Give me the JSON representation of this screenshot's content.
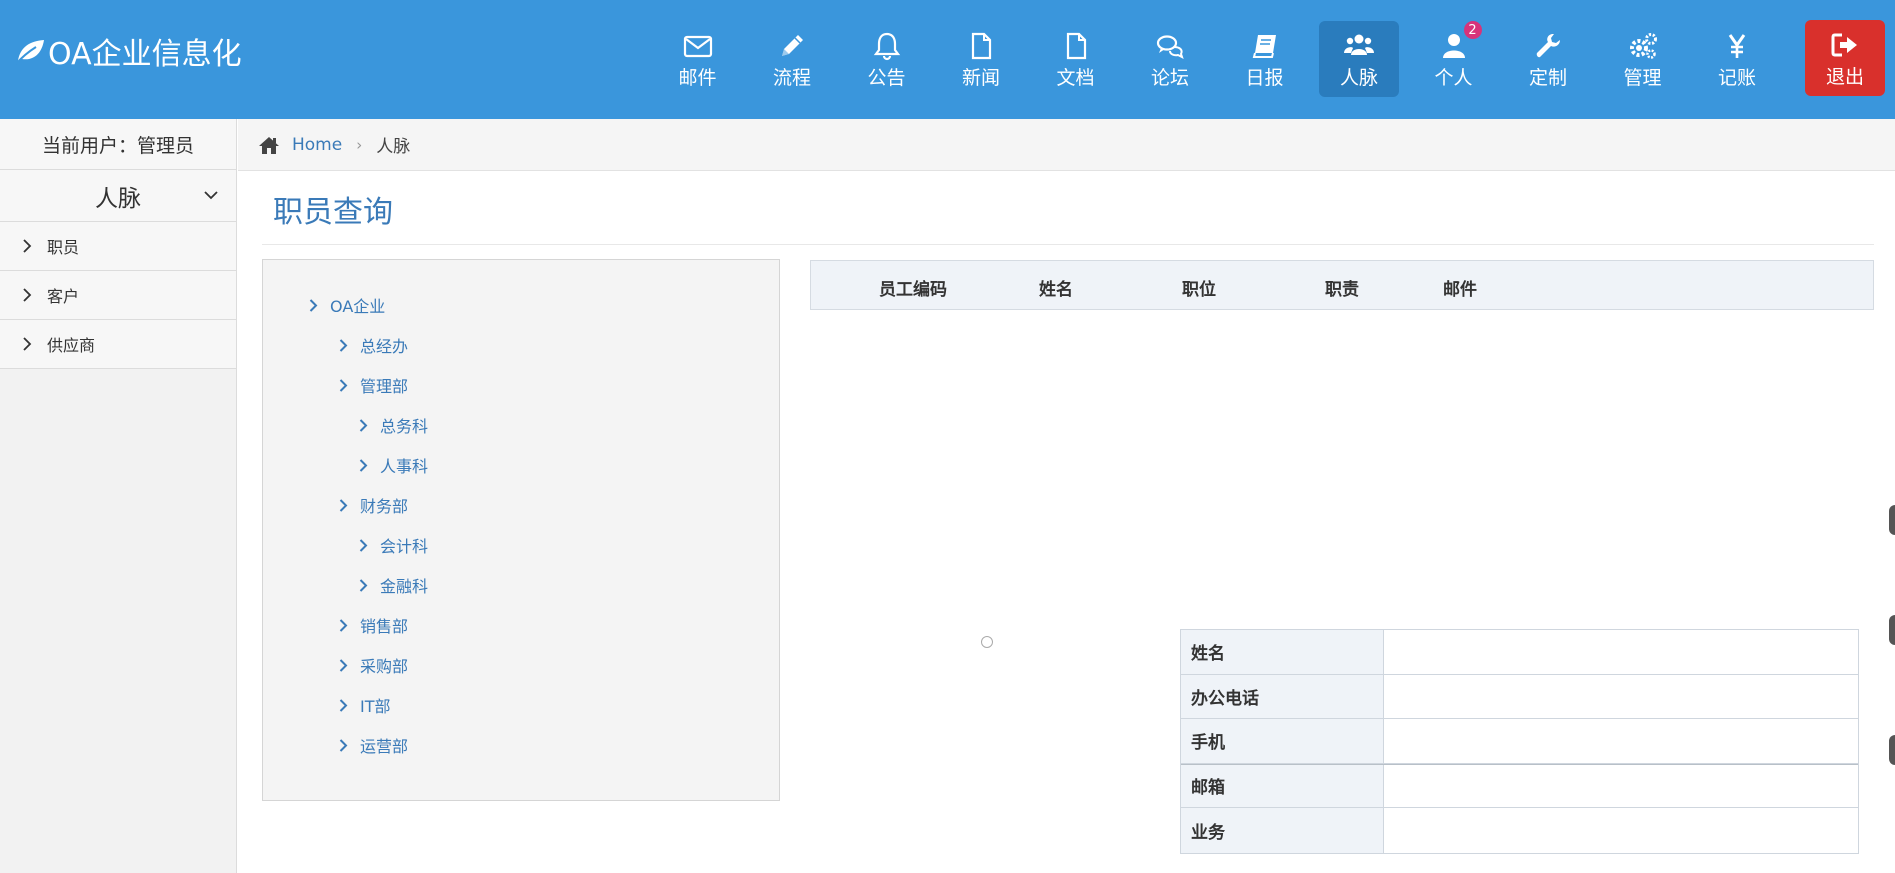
{
  "app": {
    "brand": "OA企业信息化"
  },
  "nav": {
    "items": [
      {
        "key": "mail",
        "label": "邮件",
        "icon": "envelope-icon"
      },
      {
        "key": "flow",
        "label": "流程",
        "icon": "pencil-icon"
      },
      {
        "key": "notice",
        "label": "公告",
        "icon": "bell-icon"
      },
      {
        "key": "news",
        "label": "新闻",
        "icon": "file-icon"
      },
      {
        "key": "docs",
        "label": "文档",
        "icon": "file-icon"
      },
      {
        "key": "forum",
        "label": "论坛",
        "icon": "comments-icon"
      },
      {
        "key": "daily",
        "label": "日报",
        "icon": "book-icon"
      },
      {
        "key": "contacts",
        "label": "人脉",
        "icon": "users-icon",
        "active": true
      },
      {
        "key": "personal",
        "label": "个人",
        "icon": "user-icon",
        "badge": "2"
      },
      {
        "key": "custom",
        "label": "定制",
        "icon": "wrench-icon"
      },
      {
        "key": "manage",
        "label": "管理",
        "icon": "gears-icon"
      },
      {
        "key": "ledger",
        "label": "记账",
        "icon": "yen-icon"
      }
    ],
    "logout": {
      "label": "退出",
      "icon": "sign-out-icon"
    }
  },
  "sidebar": {
    "current_user": "当前用户：管理员",
    "section": "人脉",
    "items": [
      "职员",
      "客户",
      "供应商"
    ]
  },
  "breadcrumb": {
    "home": "Home",
    "current": "人脉"
  },
  "page": {
    "title": "职员查询"
  },
  "tree": {
    "nodes": [
      {
        "label": "OA企业",
        "level": 0
      },
      {
        "label": "总经办",
        "level": 1
      },
      {
        "label": "管理部",
        "level": 1
      },
      {
        "label": "总务科",
        "level": 2
      },
      {
        "label": "人事科",
        "level": 2
      },
      {
        "label": "财务部",
        "level": 1
      },
      {
        "label": "会计科",
        "level": 2
      },
      {
        "label": "金融科",
        "level": 2
      },
      {
        "label": "销售部",
        "level": 1
      },
      {
        "label": "采购部",
        "level": 1
      },
      {
        "label": "IT部",
        "level": 1
      },
      {
        "label": "运营部",
        "level": 1
      }
    ]
  },
  "staff_table": {
    "headers": [
      "员工编码",
      "姓名",
      "职位",
      "职责",
      "邮件"
    ]
  },
  "detail": {
    "rows": [
      {
        "label": "姓名",
        "value": ""
      },
      {
        "label": "办公电话",
        "value": ""
      },
      {
        "label": "手机",
        "value": ""
      },
      {
        "label": "邮箱",
        "value": ""
      },
      {
        "label": "业务",
        "value": ""
      }
    ]
  },
  "colors": {
    "navbar": "#3a96dc",
    "active": "#2a7cbd",
    "logout": "#d9302c",
    "link": "#3a7ab8",
    "badge": "#d7337a"
  }
}
